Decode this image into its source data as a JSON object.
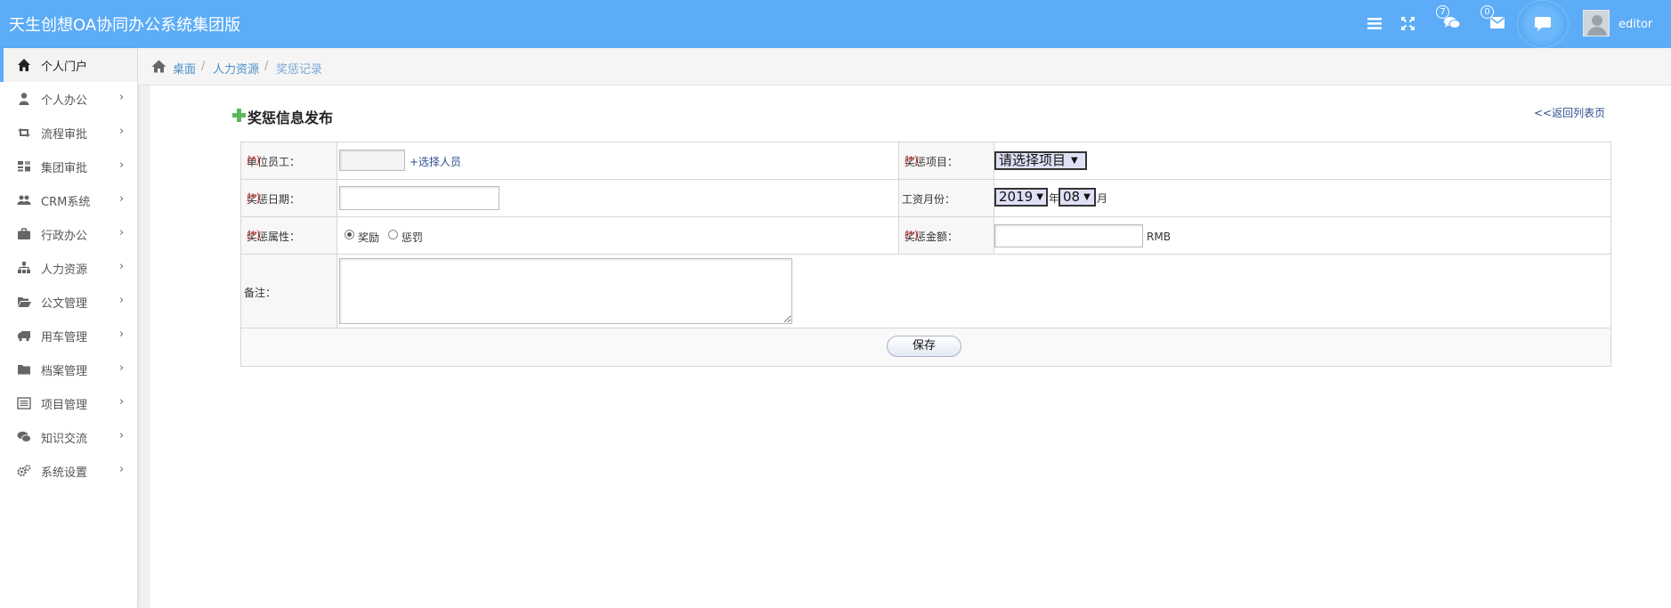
{
  "app": {
    "title": "天生创想OA协同办公系统集团版"
  },
  "header": {
    "chat_badge": "7",
    "mail_badge": "0",
    "username": "editor"
  },
  "sidebar": {
    "items": [
      {
        "label": "个人门户",
        "icon": "home-icon",
        "active": true
      },
      {
        "label": "个人办公",
        "icon": "user-icon"
      },
      {
        "label": "流程审批",
        "icon": "retweet-icon"
      },
      {
        "label": "集团审批",
        "icon": "sitemap-icon"
      },
      {
        "label": "CRM系统",
        "icon": "users-icon"
      },
      {
        "label": "行政办公",
        "icon": "briefcase-icon"
      },
      {
        "label": "人力资源",
        "icon": "org-chart-icon"
      },
      {
        "label": "公文管理",
        "icon": "folder-open-icon"
      },
      {
        "label": "用车管理",
        "icon": "truck-icon"
      },
      {
        "label": "档案管理",
        "icon": "folder-icon"
      },
      {
        "label": "项目管理",
        "icon": "list-icon"
      },
      {
        "label": "知识交流",
        "icon": "comments-icon"
      },
      {
        "label": "系统设置",
        "icon": "cogs-icon"
      }
    ]
  },
  "breadcrumb": [
    "桌面",
    "人力资源",
    "奖惩记录"
  ],
  "page": {
    "title": "奖惩信息发布",
    "back_link": "<<返回列表页"
  },
  "form": {
    "employee_label": "单位员工：",
    "required_mark": "(*)",
    "employee_value": "",
    "select_person_link": "+选择人员",
    "item_label": "奖惩项目：",
    "item_selected": "请选择项目",
    "date_label": "奖惩日期：",
    "date_value": "",
    "salary_month_label": "工资月份：",
    "year_selected": "2019",
    "year_unit": "年",
    "month_selected": "08",
    "month_unit": "月",
    "attribute_label": "奖惩属性：",
    "reward_option": "奖励",
    "punish_option": "惩罚",
    "selected_attribute": "奖励",
    "amount_label": "奖惩金额：",
    "amount_value": "",
    "amount_unit": "RMB",
    "note_label": "备注：",
    "note_value": "",
    "save_label": "保存"
  },
  "colors": {
    "header_bg": "#5cacf7",
    "link": "#2f4f8f",
    "required": "#e03030"
  }
}
